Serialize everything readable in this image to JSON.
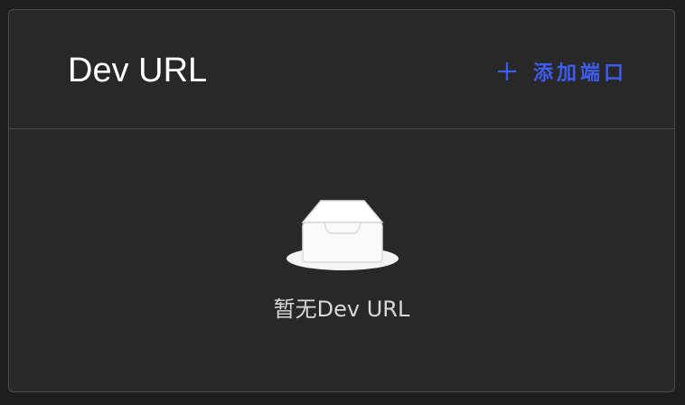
{
  "panel": {
    "title": "Dev URL",
    "add_button_label": "添加端口",
    "add_button_icon": "plus-icon"
  },
  "empty_state": {
    "icon": "empty-inbox-icon",
    "text": "暂无Dev URL"
  },
  "colors": {
    "accent": "#3d5cf0",
    "panel_bg": "#282828",
    "border": "#4a4a4a"
  }
}
